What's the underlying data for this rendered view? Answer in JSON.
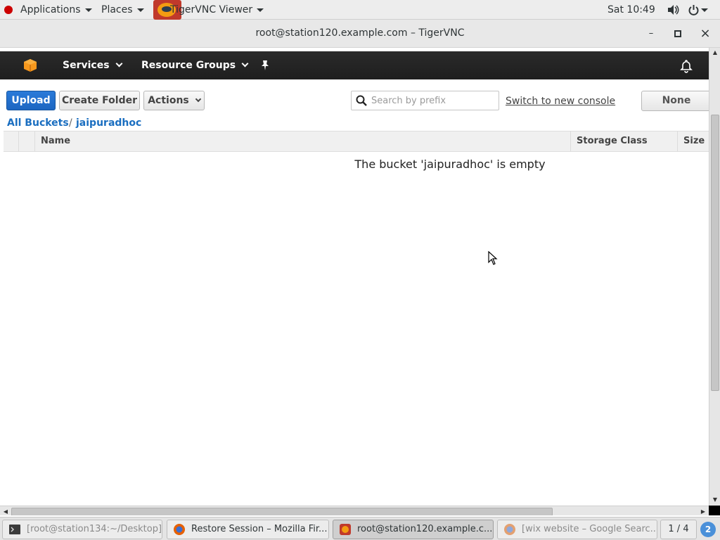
{
  "topbar": {
    "applications": "Applications",
    "places": "Places",
    "app_title": "TigerVNC Viewer",
    "clock": "Sat 10:49"
  },
  "window": {
    "title": "root@station120.example.com – TigerVNC",
    "minimize": "–",
    "maximize": "▫",
    "close": "×"
  },
  "aws": {
    "nav": {
      "services": "Services",
      "resource_groups": "Resource Groups"
    },
    "toolbar": {
      "upload": "Upload",
      "create_folder": "Create Folder",
      "actions": "Actions",
      "search_placeholder": "Search by prefix",
      "switch_console": "Switch to new console",
      "none_button": "None"
    },
    "breadcrumb": {
      "all_buckets": "All Buckets",
      "separator": "/",
      "bucket": "jaipuradhoc"
    },
    "table": {
      "columns": [
        "Name",
        "Storage Class",
        "Size"
      ],
      "empty_message": "The bucket 'jaipuradhoc' is empty"
    },
    "colors": {
      "nav_bg": "#232f3e",
      "primary": "#1d66c1",
      "link": "#1a6ec0"
    }
  },
  "taskbar": {
    "items": [
      "[root@station134:~/Desktop]",
      "Restore Session – Mozilla Fir...",
      "root@station120.example.c...",
      "[wix website – Google Searc..."
    ],
    "workspace": "1 / 4",
    "notifications": "2"
  }
}
